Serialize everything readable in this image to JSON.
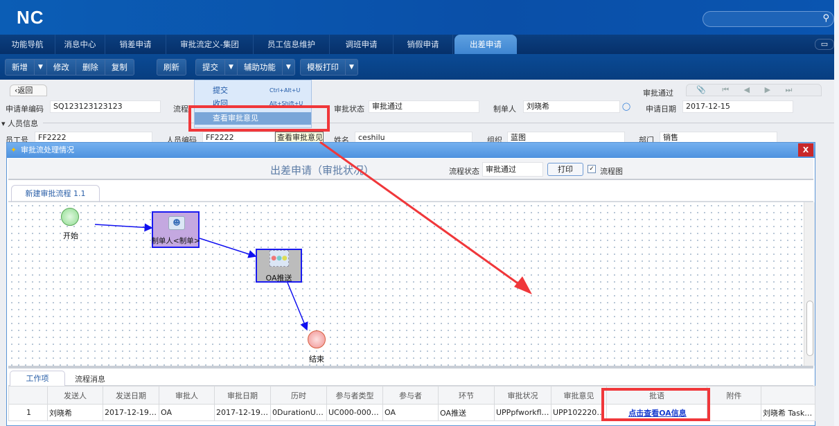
{
  "app": {
    "logo": "NC",
    "search_placeholder": ""
  },
  "tabs": [
    "功能导航",
    "消息中心",
    "销差申请",
    "审批流定义-集团",
    "员工信息维护",
    "调班申请",
    "销假申请",
    "出差申请"
  ],
  "toolbar": {
    "add": "新增",
    "edit": "修改",
    "delete": "删除",
    "copy": "复制",
    "refresh": "刷新",
    "submit": "提交",
    "assist": "辅助功能",
    "print": "模板打印"
  },
  "menu": {
    "items": [
      {
        "label": "提交",
        "shortcut": "Ctrl+Alt+U"
      },
      {
        "label": "收回",
        "shortcut": "Alt+Shift+U"
      },
      {
        "label": "查看审批意见"
      }
    ]
  },
  "form": {
    "back": "返回",
    "status_top": "审批通过",
    "bill_code_label": "申请单编码",
    "bill_code": "SQ123123123123",
    "flow_label": "流程",
    "approve_status_label": "审批状态",
    "approve_status": "审批通过",
    "maker_label": "制单人",
    "maker": "刘晓希",
    "apply_date_label": "申请日期",
    "apply_date": "2017-12-15",
    "section_person": "人员信息",
    "emp_no_label": "员工号",
    "emp_no": "FF2222",
    "person_code_label": "人员编码",
    "person_code": "FF2222",
    "tooltip": "查看审批意见",
    "name_label": "姓名",
    "name": "ceshilu",
    "org_label": "组织",
    "org": "蓝图",
    "dept_label": "部门",
    "dept": "销售"
  },
  "dialog": {
    "title": "审批流处理情况",
    "close": "X",
    "heading": "出差申请（审批状况）",
    "flow_status_label": "流程状态",
    "flow_status": "审批通过",
    "print": "打印",
    "flowchart_label": "流程图",
    "flowchart_checked": true,
    "flow_tab": "新建审批流程 1.1",
    "nodes": {
      "start": "开始",
      "maker": "制单人<制单>",
      "oa": "OA推送",
      "end": "结束"
    },
    "bottom_tabs": [
      "工作项",
      "流程消息"
    ],
    "columns": [
      "",
      "发送人",
      "发送日期",
      "审批人",
      "审批日期",
      "历时",
      "参与者类型",
      "参与者",
      "环节",
      "审批状况",
      "审批意见",
      "批语",
      "附件",
      ""
    ],
    "rows": [
      [
        "1",
        "刘晓希",
        "2017-12-19 1...",
        "OA",
        "2017-12-19 1...",
        "0DurationUnit...",
        "UC000-0002...",
        "OA",
        "OA推送",
        "UPPpfworkflo...",
        "UPP102220-...",
        "点击查看OA信息",
        "",
        "刘晓希 TaskTop"
      ]
    ]
  },
  "colors": {
    "accent": "#0a55b0",
    "highlight": "#f0373a",
    "link": "#1a3fd0"
  }
}
